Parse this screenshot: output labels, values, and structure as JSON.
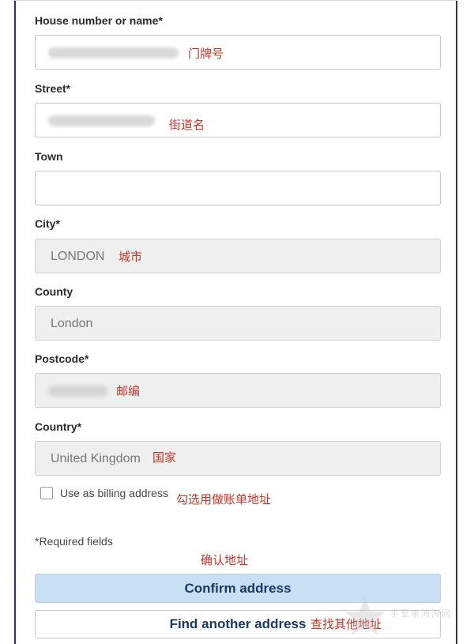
{
  "form": {
    "house": {
      "label": "House number or name*",
      "note": "门牌号"
    },
    "street": {
      "label": "Street*",
      "note": "街道名"
    },
    "town": {
      "label": "Town",
      "value": ""
    },
    "city": {
      "label": "City*",
      "value": "LONDON",
      "note": "城市"
    },
    "county": {
      "label": "County",
      "value": "London"
    },
    "postcode": {
      "label": "Postcode*",
      "note": "邮编"
    },
    "country": {
      "label": "Country*",
      "value": "United Kingdom",
      "note": "国家"
    },
    "billing": {
      "label": "Use as billing address",
      "checked": false,
      "note": "勾选用做账单地址"
    },
    "required_note": "*Required fields"
  },
  "actions": {
    "confirm_note": "确认地址",
    "confirm_label": "Confirm address",
    "find_label": "Find another address",
    "find_note": "查找其他地址"
  },
  "watermark": {
    "text": "手里来海淘网"
  },
  "colors": {
    "frame_border": "#1f3a64",
    "annotation": "#c0392b",
    "confirm_bg": "#c9dff3",
    "button_text": "#1a3a63",
    "readonly_bg": "#efefef"
  }
}
